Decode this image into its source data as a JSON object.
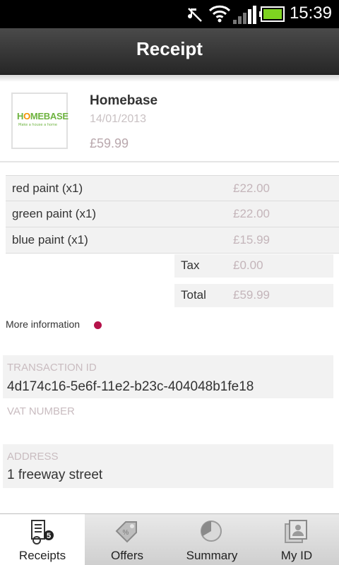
{
  "status_bar": {
    "time": "15:39"
  },
  "header": {
    "title": "Receipt"
  },
  "merchant": {
    "logo_text_a": "H",
    "logo_text_o": "O",
    "logo_text_b": "MEBASE",
    "logo_tagline": "Make a house a home",
    "name": "Homebase",
    "date": "14/01/2013",
    "total": "£59.99"
  },
  "items": [
    {
      "name": "red paint (x1)",
      "price": "£22.00"
    },
    {
      "name": "green paint (x1)",
      "price": "£22.00"
    },
    {
      "name": "blue paint (x1)",
      "price": "£15.99"
    }
  ],
  "totals": {
    "tax_label": "Tax",
    "tax_value": "£0.00",
    "total_label": "Total",
    "total_value": "£59.99"
  },
  "more_info": {
    "label": "More information"
  },
  "transaction": {
    "label": "TRANSACTION ID",
    "value": "4d174c16-5e6f-11e2-b23c-404048b1fe18"
  },
  "vat": {
    "label": "VAT NUMBER",
    "value": ""
  },
  "address": {
    "label": "ADDRESS",
    "value": "1 freeway street"
  },
  "tabs": [
    {
      "label": "Receipts",
      "icon": "receipt-icon",
      "badge": "5",
      "active": true
    },
    {
      "label": "Offers",
      "icon": "tag-icon",
      "active": false
    },
    {
      "label": "Summary",
      "icon": "pie-chart-icon",
      "active": false
    },
    {
      "label": "My ID",
      "icon": "id-card-icon",
      "active": false
    }
  ],
  "colors": {
    "accent": "#b5124a",
    "muted_text": "#c4b5ba"
  }
}
